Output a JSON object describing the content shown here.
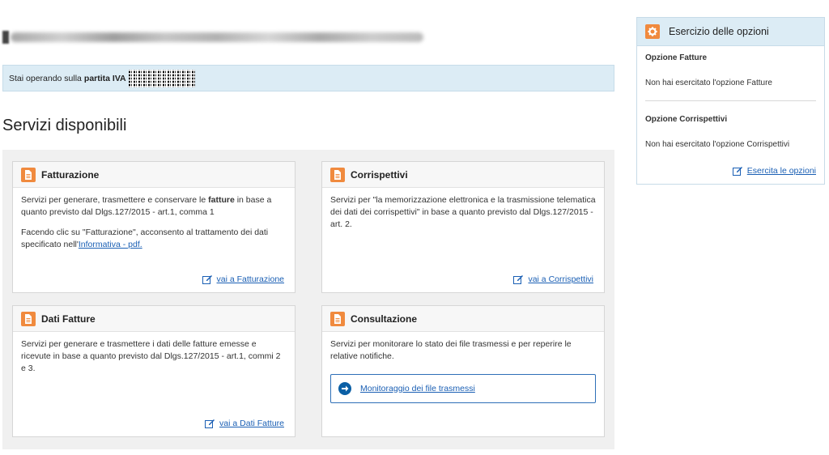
{
  "header": {
    "iva_prefix": "Stai operando sulla",
    "iva_label": "partita IVA"
  },
  "servizi_title": "Servizi disponibili",
  "cards": {
    "fatturazione": {
      "title": "Fatturazione",
      "text_before": "Servizi per generare, trasmettere e conservare le ",
      "text_bold": "fatture",
      "text_after": " in base a quanto previsto dal Dlgs.127/2015 - art.1, comma 1",
      "consent_text": "Facendo clic su \"Fatturazione\", acconsento al trattamento dei dati specificato nell'",
      "consent_link": "Informativa - pdf.",
      "link": "vai a Fatturazione"
    },
    "corrispettivi": {
      "title": "Corrispettivi",
      "text": "Servizi per \"la memorizzazione elettronica e la trasmissione telematica dei dati dei corrispettivi\" in base a quanto previsto dal Dlgs.127/2015 - art. 2.",
      "link": "vai a Corrispettivi"
    },
    "dati_fatture": {
      "title": "Dati Fatture",
      "text": "Servizi per generare e trasmettere i dati delle fatture emesse e ricevute in base a quanto previsto dal Dlgs.127/2015 - art.1, commi 2 e 3.",
      "link": "vai a Dati Fatture"
    },
    "consultazione": {
      "title": "Consultazione",
      "text": "Servizi per monitorare lo stato dei file trasmessi e per reperire le relative notifiche.",
      "monitor_link": "Monitoraggio dei file trasmessi"
    }
  },
  "opzioni": {
    "title": "Esercizio delle opzioni",
    "fatture_label": "Opzione Fatture",
    "fatture_text": "Non hai esercitato l'opzione Fatture",
    "corrispettivi_label": "Opzione Corrispettivi",
    "corrispettivi_text": "Non hai esercitato l'opzione Corrispettivi",
    "link": "Esercita le opzioni"
  },
  "colors": {
    "accent_orange": "#f08a3e",
    "info_blue_bg": "#dcecf5",
    "link_blue": "#1a5fb4"
  }
}
